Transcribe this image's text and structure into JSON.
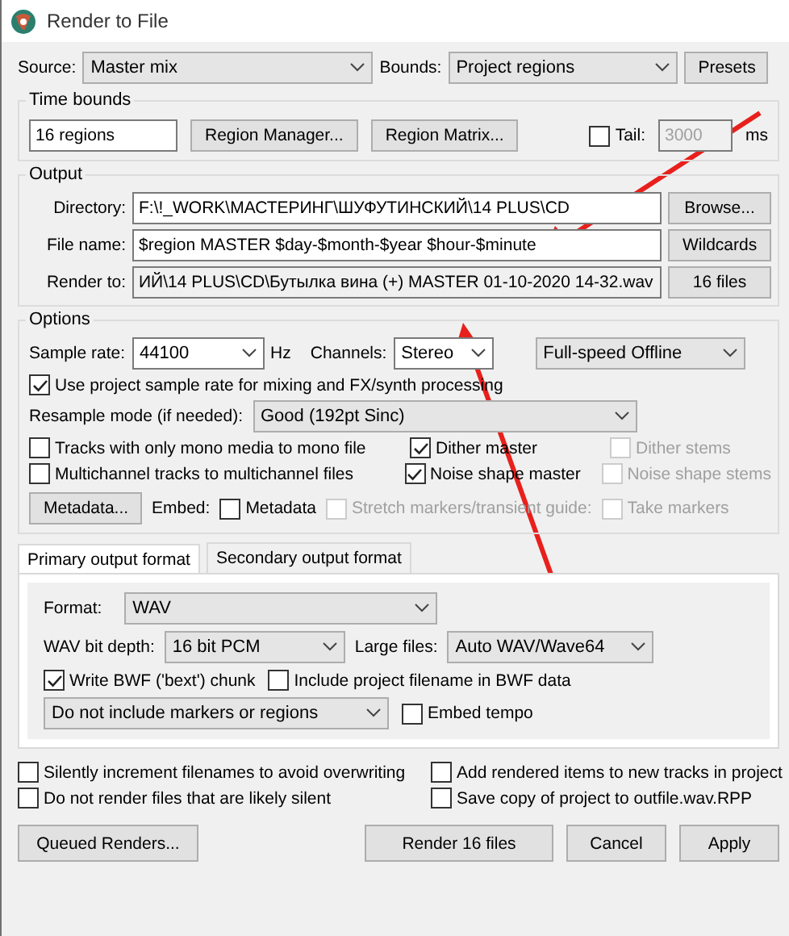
{
  "window": {
    "title": "Render to File"
  },
  "source": {
    "label": "Source:",
    "value": "Master mix"
  },
  "bounds": {
    "label": "Bounds:",
    "value": "Project regions"
  },
  "presets_button": "Presets",
  "time_bounds": {
    "title": "Time bounds",
    "regions": "16 regions",
    "buttons": [
      "Region Manager...",
      "Region Matrix..."
    ],
    "tail": {
      "label": "Tail:",
      "checked": false,
      "disabled": true,
      "value": "3000",
      "unit": "ms"
    }
  },
  "output": {
    "title": "Output",
    "rows": [
      {
        "label": "Directory:",
        "value": "F:\\!_WORK\\МАСТЕРИНГ\\ШУФУТИНСКИЙ\\14 PLUS\\CD",
        "button": "Browse...",
        "readonly": false
      },
      {
        "label": "File name:",
        "value": "$region MASTER $day-$month-$year $hour-$minute",
        "button": "Wildcards",
        "readonly": false
      },
      {
        "label": "Render to:",
        "value": "ИЙ\\14 PLUS\\CD\\Бутылка вина (+) MASTER 01-10-2020 14-32.wav",
        "button": "16 files",
        "readonly": true
      }
    ]
  },
  "options": {
    "title": "Options",
    "sample_rate": {
      "label": "Sample rate:",
      "value": "44100",
      "unit": "Hz"
    },
    "channels": {
      "label": "Channels:",
      "value": "Stereo"
    },
    "speed": "Full-speed Offline",
    "use_project_rate": {
      "label": "Use project sample rate for mixing and FX/synth processing",
      "checked": true
    },
    "resample": {
      "label": "Resample mode (if needed):",
      "value": "Good (192pt Sinc)"
    },
    "checks": [
      {
        "label": "Tracks with only mono media to mono file",
        "checked": false,
        "disabled": false
      },
      {
        "label": "Dither master",
        "checked": true,
        "disabled": false
      },
      {
        "label": "Dither stems",
        "checked": false,
        "disabled": true
      },
      {
        "label": "Multichannel tracks to multichannel files",
        "checked": false,
        "disabled": false
      },
      {
        "label": "Noise shape master",
        "checked": true,
        "disabled": false
      },
      {
        "label": "Noise shape stems",
        "checked": false,
        "disabled": true
      }
    ],
    "metadata_button": "Metadata...",
    "embed_label": "Embed:",
    "embed": [
      {
        "label": "Metadata",
        "checked": false,
        "disabled": false
      },
      {
        "label": "Stretch markers/transient guide:",
        "checked": false,
        "disabled": true
      },
      {
        "label": "Take markers",
        "checked": false,
        "disabled": true
      }
    ]
  },
  "tabs": [
    {
      "label": "Primary output format",
      "selected": true
    },
    {
      "label": "Secondary output format",
      "selected": false
    }
  ],
  "format": {
    "format": {
      "label": "Format:",
      "value": "WAV"
    },
    "bit_depth": {
      "label": "WAV bit depth:",
      "value": "16 bit PCM"
    },
    "large_files": {
      "label": "Large files:",
      "value": "Auto WAV/Wave64"
    },
    "bwf": {
      "label": "Write BWF ('bext') chunk",
      "checked": true
    },
    "include_filename": {
      "label": "Include project filename in BWF data",
      "checked": false
    },
    "markers": "Do not include markers or regions",
    "embed_tempo": {
      "label": "Embed tempo",
      "checked": false
    }
  },
  "bottom_checks": [
    {
      "label": "Silently increment filenames to avoid overwriting",
      "checked": false
    },
    {
      "label": "Add rendered items to new tracks in project",
      "checked": false
    },
    {
      "label": "Do not render files that are likely silent",
      "checked": false
    },
    {
      "label": "Save copy of project to outfile.wav.RPP",
      "checked": false
    }
  ],
  "buttons": [
    "Queued Renders...",
    "Render 16 files",
    "Cancel",
    "Apply"
  ]
}
